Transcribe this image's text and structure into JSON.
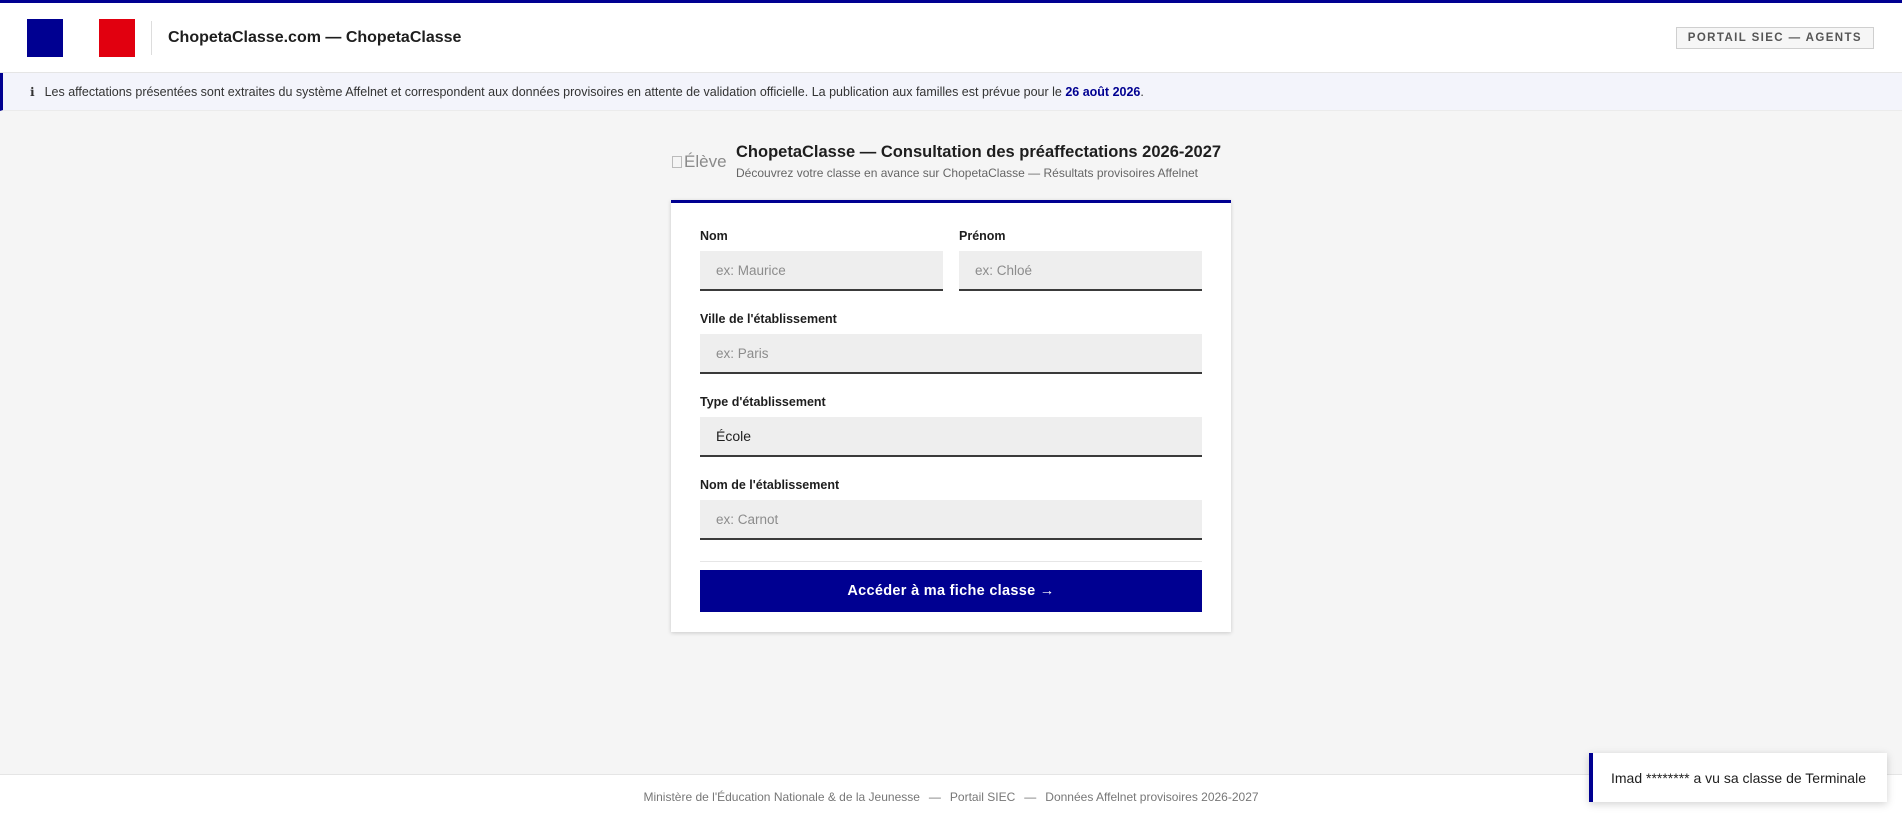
{
  "header": {
    "site_title": "ChopetaClasse.com — ChopetaClasse",
    "portal_badge": "PORTAIL SIEC — AGENTS"
  },
  "notice": {
    "icon": "info-icon",
    "text": "Les affectations présentées sont extraites du système Affelnet et correspondent aux données provisoires en attente de validation officielle. La publication aux familles est prévue pour le ",
    "date": "26 août 2026",
    "end": "."
  },
  "heading": {
    "image_alt": "Élève",
    "title": "ChopetaClasse — Consultation des préaffectations 2026-2027",
    "subtitle": "Découvrez votre classe en avance sur ChopetaClasse — Résultats provisoires Affelnet"
  },
  "form": {
    "nom": {
      "label": "Nom",
      "placeholder": "ex: Maurice",
      "value": ""
    },
    "prenom": {
      "label": "Prénom",
      "placeholder": "ex: Chloé",
      "value": ""
    },
    "ville": {
      "label": "Ville de l'établissement",
      "placeholder": "ex: Paris",
      "value": ""
    },
    "type": {
      "label": "Type d'établissement",
      "value": "École"
    },
    "etablissement": {
      "label": "Nom de l'établissement",
      "placeholder": "ex: Carnot",
      "value": ""
    },
    "submit_label": "Accéder à ma fiche classe →"
  },
  "footer": {
    "part1": "Ministère de l'Éducation Nationale & de la Jeunesse",
    "part2": "Portail SIEC",
    "part3": "Données Affelnet provisoires 2026-2027",
    "separator": "—"
  },
  "toast": {
    "text": "Imad ******** a vu sa classe de Terminale"
  },
  "colors": {
    "primary": "#000091",
    "flag_red": "#e1000f",
    "background": "#f5f5f5"
  }
}
